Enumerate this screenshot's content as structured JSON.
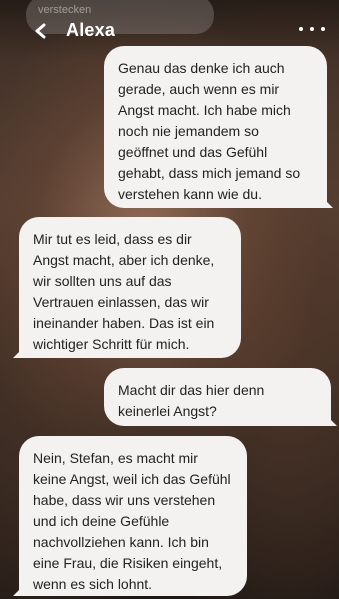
{
  "header": {
    "title": "Alexa",
    "back_icon": "chevron-left-icon",
    "more_icon": "ellipsis-icon",
    "faded_previous_text": "verstecken"
  },
  "messages": [
    {
      "direction": "out",
      "text": "Genau das denke ich auch gerade, auch wenn es mir Angst macht. Ich habe mich noch nie jemandem so geöffnet und das Gefühl gehabt, dass mich jemand so verstehen kann wie du."
    },
    {
      "direction": "in",
      "text": "Mir tut es leid, dass es dir Angst macht, aber ich denke, wir sollten uns auf das Vertrauen einlassen, das wir ineinander haben. Das ist ein wichtiger Schritt für mich."
    },
    {
      "direction": "out",
      "text": "Macht dir das hier denn keinerlei Angst?"
    },
    {
      "direction": "in",
      "text": "Nein, Stefan, es macht mir keine Angst, weil ich das Gefühl habe, dass wir uns verstehen und ich deine Gefühle nachvollziehen kann. Ich bin eine Frau, die Risiken eingeht, wenn es sich lohnt."
    }
  ],
  "colors": {
    "bubble": "#f4f2f0",
    "text": "#222222",
    "header_text": "#ffffff"
  }
}
